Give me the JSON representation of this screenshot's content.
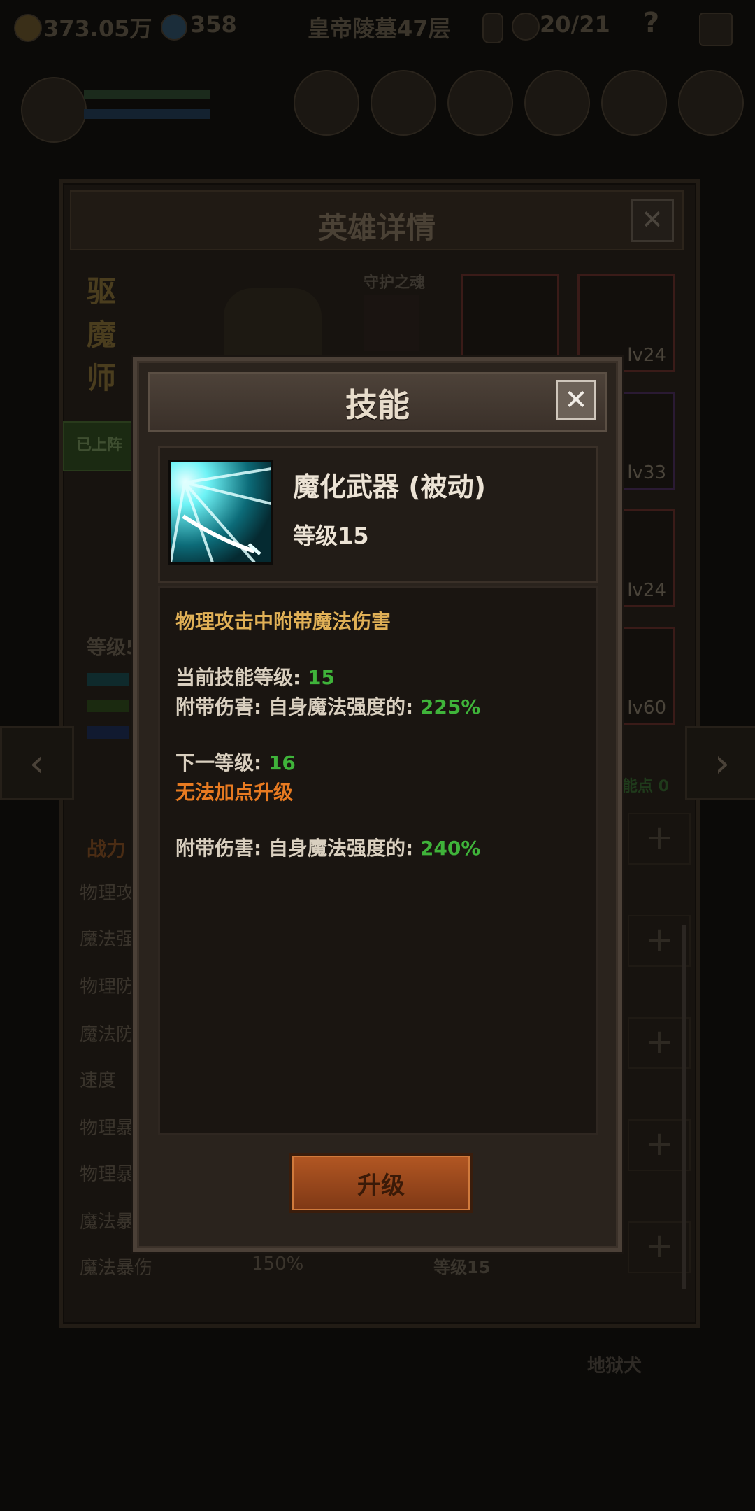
{
  "topbar": {
    "gold": "373.05万",
    "gems": "358",
    "stage": "皇帝陵墓47层",
    "keys": "20/21",
    "help": "?"
  },
  "hero_detail": {
    "title": "英雄详情",
    "class_name": "驱魔师",
    "guardian_label": "守护之魂",
    "deployed_badge": "已上阵",
    "level_label": "等级5",
    "skill_points_label": "能点 0",
    "power_label": "战力",
    "stats": [
      "物理攻",
      "魔法强",
      "物理防",
      "魔法防",
      "速度",
      "物理暴",
      "物理暴",
      "魔法暴",
      "魔法暴伤"
    ],
    "magic_crit_damage_value": "150%",
    "slot_levels": [
      "lv24",
      "lv33",
      "lv24",
      "lv60"
    ],
    "behind_skill_level": "等级15",
    "bottom_label": "地狱犬"
  },
  "skill_modal": {
    "title": "技能",
    "close_icon": "close-icon",
    "skill_name": "魔化武器 (被动)",
    "skill_level": "等级15",
    "summary": "物理攻击中附带魔法伤害",
    "current_level_label": "当前技能等级: ",
    "current_level_value": "15",
    "bonus_label_current": "附带伤害: 自身魔法强度的: ",
    "bonus_value_current": "225%",
    "next_level_label": "下一等级: ",
    "next_level_value": "16",
    "cannot_upgrade": "无法加点升级",
    "bonus_label_next": "附带伤害: 自身魔法强度的: ",
    "bonus_value_next": "240%",
    "upgrade_button": "升级"
  },
  "colors": {
    "gold_text": "#e0b056",
    "green_value": "#3fb33a",
    "orange_warning": "#e77a21",
    "button_orange": "#b25723"
  }
}
